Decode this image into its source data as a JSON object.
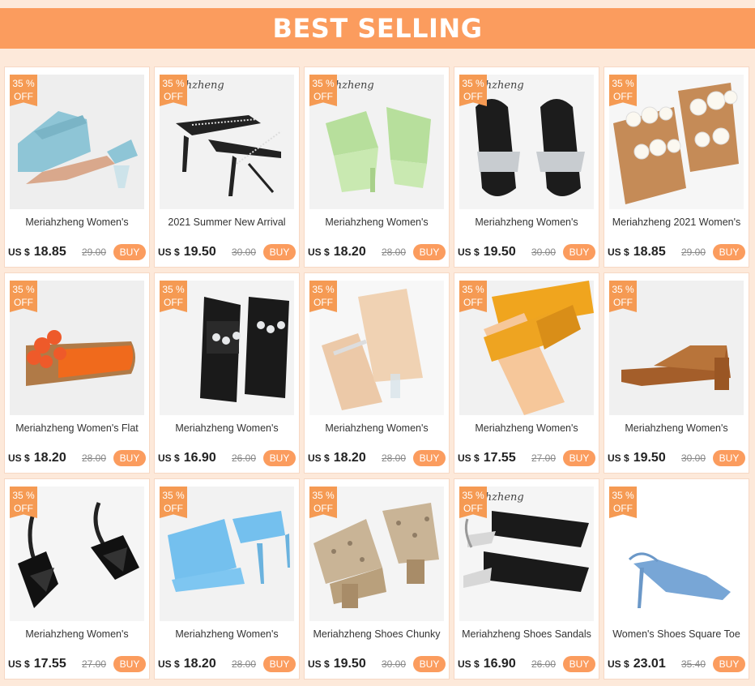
{
  "header": {
    "title": "BEST SELLING"
  },
  "currency_label": "US $",
  "buy_label": "BUY",
  "badge": {
    "percent": "35 %",
    "off": "OFF"
  },
  "products": [
    {
      "name": "Meriahzheng Women's",
      "price": "18.85",
      "old_price": "29.00",
      "image": "blue-woven-mule-icon",
      "watermark": ""
    },
    {
      "name": "2021 Summer New Arrival",
      "price": "19.50",
      "old_price": "30.00",
      "image": "black-crystal-strap-heel-icon",
      "watermark": "ahzheng"
    },
    {
      "name": "Meriahzheng Women's",
      "price": "18.20",
      "old_price": "28.00",
      "image": "green-square-mule-icon",
      "watermark": "ahzheng"
    },
    {
      "name": "Meriahzheng Women's",
      "price": "19.50",
      "old_price": "30.00",
      "image": "black-crystal-flat-icon",
      "watermark": "ahzheng"
    },
    {
      "name": "Meriahzheng 2021 Women's",
      "price": "18.85",
      "old_price": "29.00",
      "image": "pearl-slide-icon",
      "watermark": ""
    },
    {
      "name": "Meriahzheng Women's Flat",
      "price": "18.20",
      "old_price": "28.00",
      "image": "orange-flower-flat-icon",
      "watermark": ""
    },
    {
      "name": "Meriahzheng Women's",
      "price": "16.90",
      "old_price": "26.00",
      "image": "black-jewel-slide-icon",
      "watermark": ""
    },
    {
      "name": "Meriahzheng Women's",
      "price": "18.20",
      "old_price": "28.00",
      "image": "nude-clear-heel-icon",
      "watermark": ""
    },
    {
      "name": "Meriahzheng Women's",
      "price": "17.55",
      "old_price": "27.00",
      "image": "yellow-woven-slide-icon",
      "watermark": ""
    },
    {
      "name": "Meriahzheng Women's",
      "price": "19.50",
      "old_price": "30.00",
      "image": "brown-block-mule-icon",
      "watermark": ""
    },
    {
      "name": "Meriahzheng Women's",
      "price": "17.55",
      "old_price": "27.00",
      "image": "black-bow-sandal-icon",
      "watermark": ""
    },
    {
      "name": "Meriahzheng Women's",
      "price": "18.20",
      "old_price": "28.00",
      "image": "blue-cross-heel-icon",
      "watermark": ""
    },
    {
      "name": "Meriahzheng Shoes Chunky",
      "price": "19.50",
      "old_price": "30.00",
      "image": "snakeskin-mule-icon",
      "watermark": ""
    },
    {
      "name": "Meriahzheng Shoes Sandals",
      "price": "16.90",
      "old_price": "26.00",
      "image": "slingback-flat-icon",
      "watermark": "ahzheng"
    },
    {
      "name": "Women's Shoes Square Toe",
      "price": "23.01",
      "old_price": "35.40",
      "image": "blue-slingback-heel-icon",
      "watermark": ""
    }
  ]
}
